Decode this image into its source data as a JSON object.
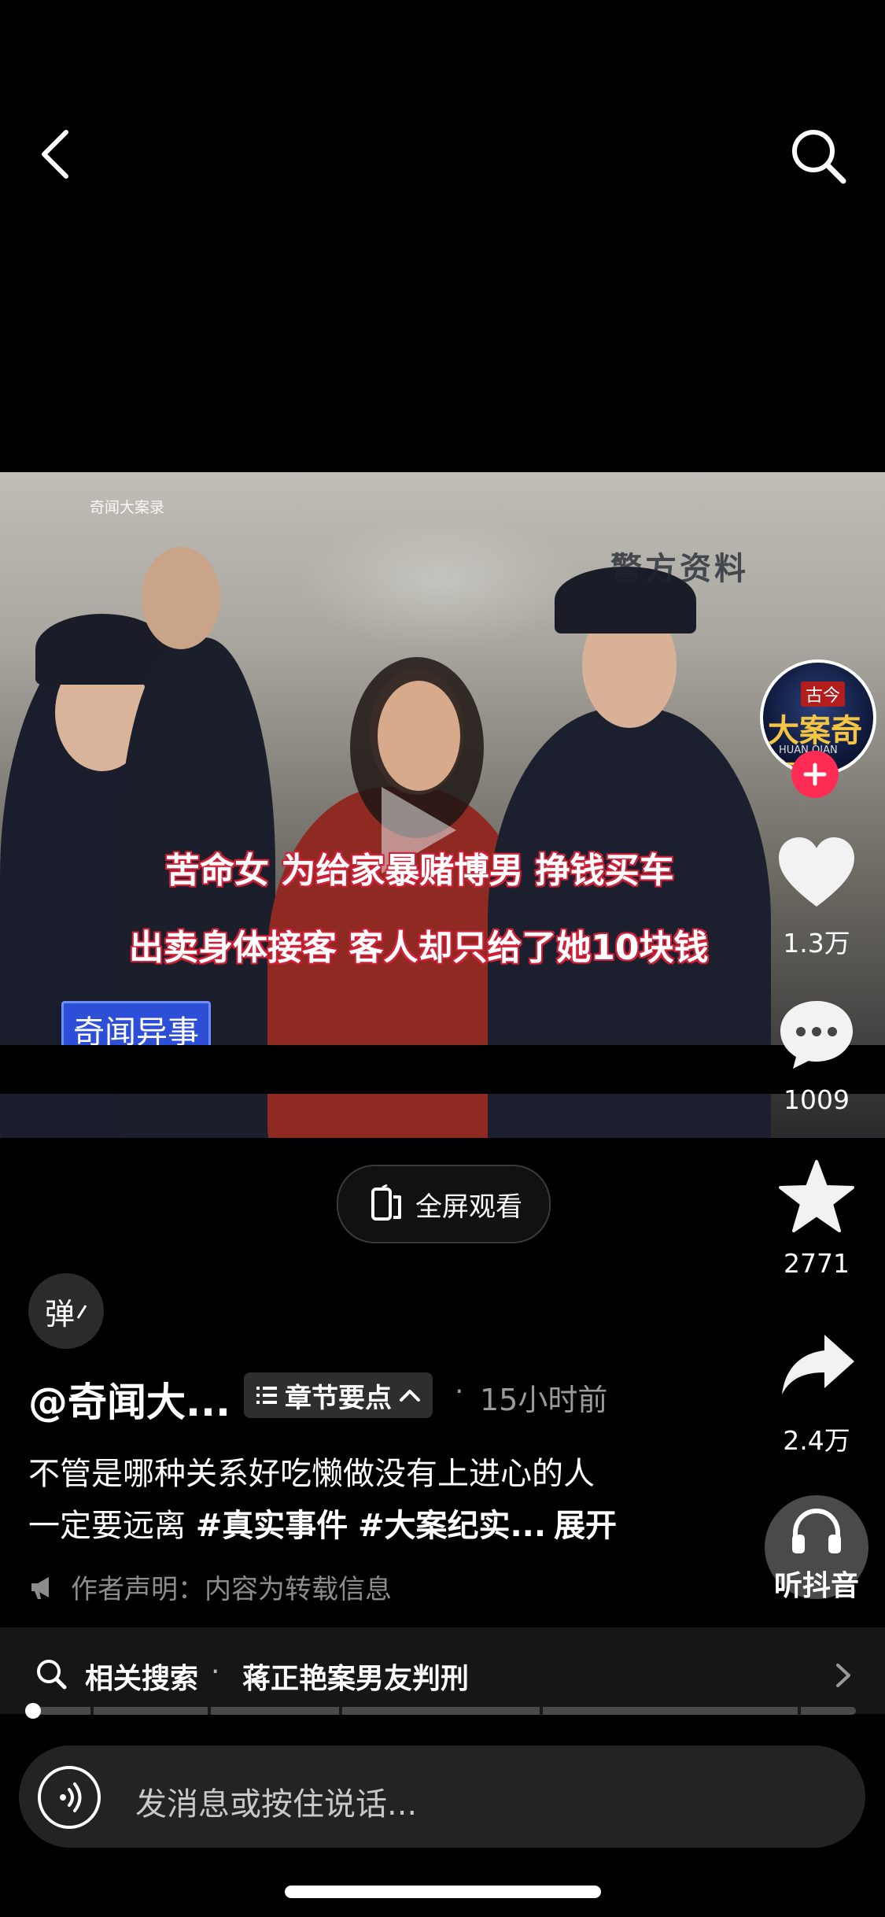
{
  "nav": {
    "back_icon": "chevron-left-icon",
    "search_icon": "search-icon"
  },
  "video": {
    "channel_watermark": "奇闻大案录",
    "source_watermark": "警方资料",
    "subtitle_line1": "苦命女 为给家暴赌博男 挣钱买车",
    "subtitle_line2": "出卖身体接客 客人却只给了她10块钱",
    "tag_badge": "奇闻异事",
    "fullscreen_label": "全屏观看"
  },
  "rail": {
    "avatar": {
      "top_text": "古今",
      "main_text": "大案奇案",
      "sub_text": "HUAN QIAN"
    },
    "likes": "1.3万",
    "comments": "1009",
    "favorites": "2771",
    "shares": "2.4万",
    "listen_label": "听抖音"
  },
  "info": {
    "danmaku_label": "弹",
    "author": "@奇闻大...",
    "chapter_label": "章节要点",
    "dot": "·",
    "time_ago": "15小时前",
    "caption_line1": "不管是哪种关系好吃懒做没有上进心的人",
    "caption_line2_text": "一定要远离 ",
    "caption_tag1": "#真实事件",
    "caption_tag2": "#大案纪实...",
    "expand_label": "展开",
    "declaration": "作者声明：内容为转载信息"
  },
  "related": {
    "label": "相关搜索",
    "dot": "·",
    "query": "蒋正艳案男友判刑"
  },
  "progress": {
    "played_fraction": 0.0,
    "chapter_fractions": [
      0.075,
      0.217,
      0.375,
      0.618,
      0.93
    ]
  },
  "message": {
    "placeholder": "发消息或按住说话..."
  },
  "colors": {
    "accent_red": "#fe2c55",
    "badge_blue": "#2d4ed6",
    "subtitle_outline": "#d0223a"
  }
}
